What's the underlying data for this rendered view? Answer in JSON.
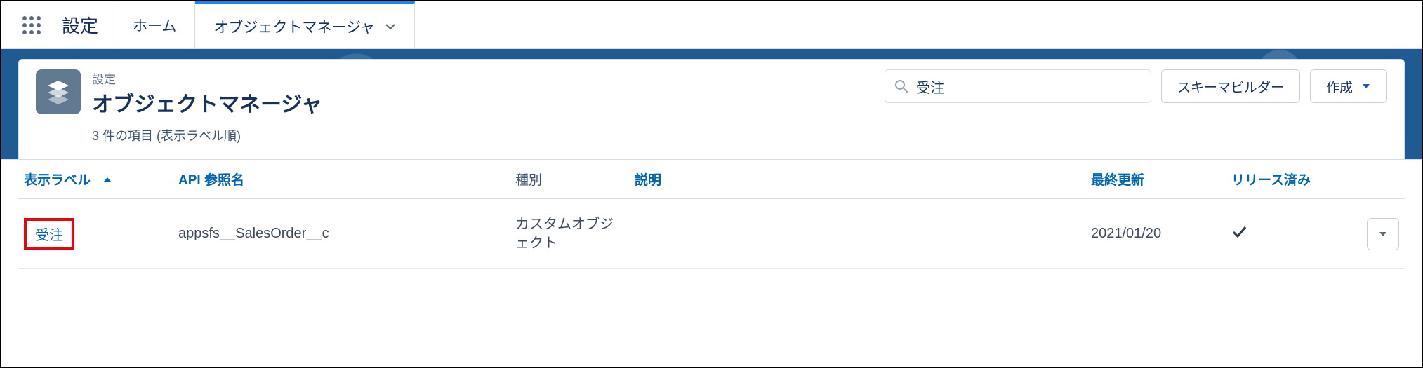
{
  "topnav": {
    "brand": "設定",
    "tabs": [
      {
        "label": "ホーム",
        "active": false,
        "hasMenu": false
      },
      {
        "label": "オブジェクトマネージャ",
        "active": true,
        "hasMenu": true
      }
    ]
  },
  "hero": {
    "set_label": "設定",
    "title": "オブジェクトマネージャ",
    "subtitle": "3 件の項目 (表示ラベル順)"
  },
  "search": {
    "value": "受注"
  },
  "buttons": {
    "schema_builder": "スキーマビルダー",
    "create": "作成"
  },
  "columns": {
    "label": "表示ラベル",
    "api": "API 参照名",
    "type": "種別",
    "desc": "説明",
    "updated": "最終更新",
    "released": "リリース済み"
  },
  "rows": [
    {
      "label": "受注",
      "api": "appsfs__SalesOrder__c",
      "type": "カスタムオブジェクト",
      "desc": "",
      "updated": "2021/01/20",
      "released": true,
      "highlighted": true
    }
  ]
}
